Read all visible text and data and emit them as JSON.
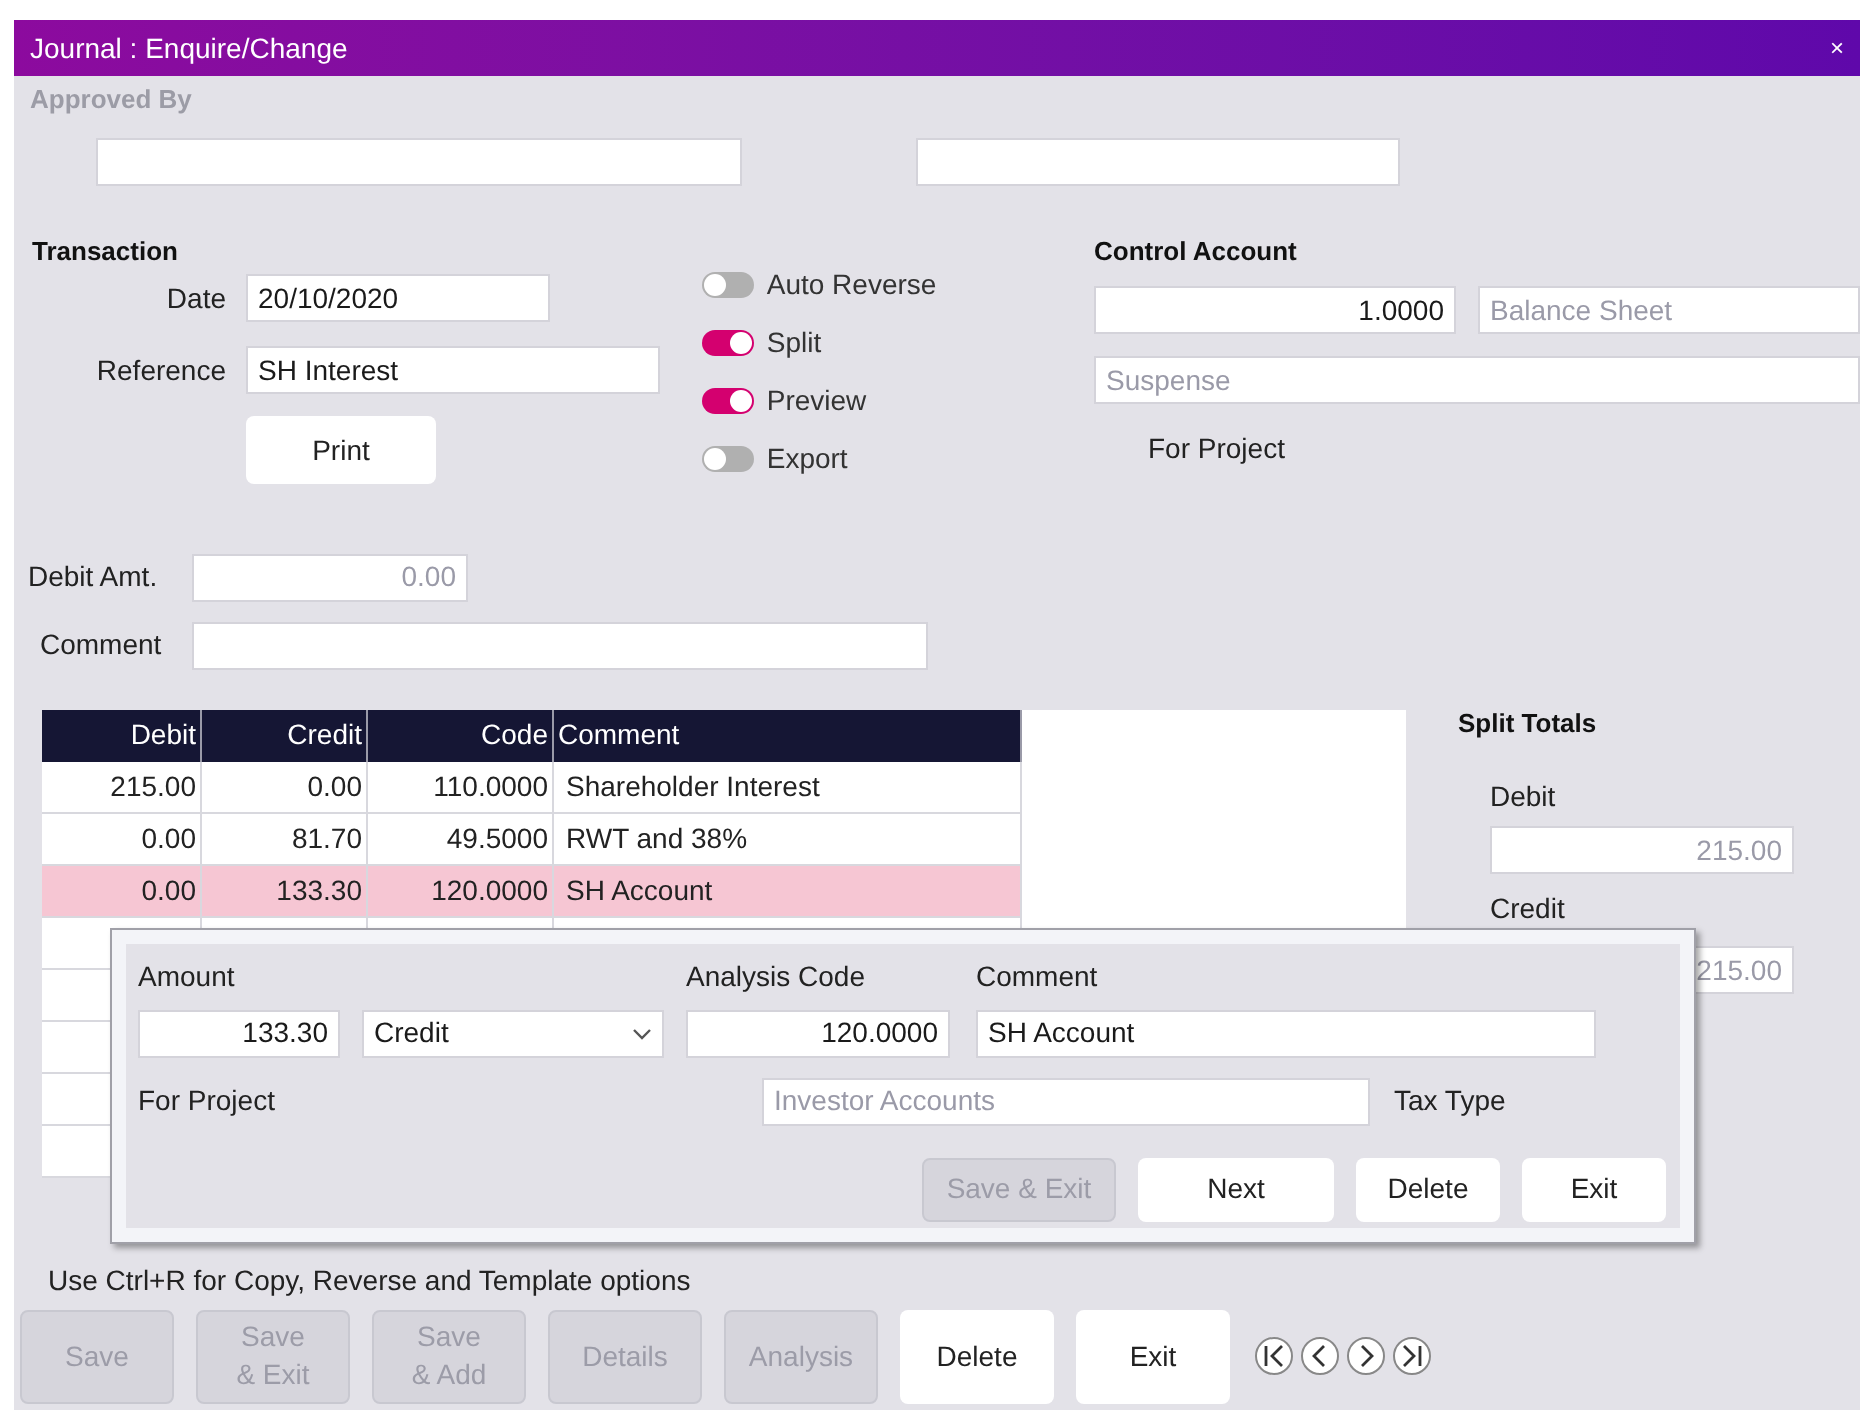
{
  "window": {
    "title": "Journal : Enquire/Change",
    "close": "×"
  },
  "approved_by": {
    "label": "Approved By"
  },
  "transaction": {
    "heading": "Transaction",
    "date": {
      "label": "Date",
      "value": "20/10/2020"
    },
    "reference": {
      "label": "Reference",
      "value": "SH Interest"
    },
    "print_button": "Print"
  },
  "toggles": [
    {
      "label": "Auto Reverse",
      "on": false
    },
    {
      "label": "Split",
      "on": true
    },
    {
      "label": "Preview",
      "on": true
    },
    {
      "label": "Export",
      "on": false
    }
  ],
  "control_account": {
    "heading": "Control Account",
    "rate": "1.0000",
    "type": "Balance Sheet",
    "account": "Suspense",
    "for_project": "For Project"
  },
  "debit_amount": {
    "label": "Debit Amt.",
    "value": "0.00"
  },
  "comment": {
    "label": "Comment"
  },
  "table": {
    "columns": [
      "Debit",
      "Credit",
      "Code",
      "Comment"
    ],
    "rows": [
      {
        "cells": [
          "215.00",
          "0.00",
          "110.0000",
          "Shareholder Interest"
        ],
        "selected": false
      },
      {
        "cells": [
          "0.00",
          "81.70",
          "49.5000",
          "RWT and 38%"
        ],
        "selected": false
      },
      {
        "cells": [
          "0.00",
          "133.30",
          "120.0000",
          "SH Account"
        ],
        "selected": true
      }
    ]
  },
  "split_totals": {
    "heading": "Split Totals",
    "debit": {
      "label": "Debit",
      "value": "215.00"
    },
    "credit": {
      "label": "Credit",
      "value": "215.00"
    }
  },
  "dialog": {
    "amount": {
      "label": "Amount",
      "value": "133.30"
    },
    "side": "Credit",
    "analysis_code": {
      "label": "Analysis Code",
      "value": "120.0000"
    },
    "comment": {
      "label": "Comment",
      "value": "SH Account"
    },
    "for_project": {
      "label": "For Project",
      "value": "Investor Accounts"
    },
    "tax_type": {
      "label": "Tax Type"
    },
    "buttons": [
      {
        "label": "Save & Exit",
        "disabled": true
      },
      {
        "label": "Next",
        "disabled": false
      },
      {
        "label": "Delete",
        "disabled": false
      },
      {
        "label": "Exit",
        "disabled": false
      }
    ]
  },
  "hint": "Use Ctrl+R for Copy, Reverse and Template options",
  "buttons": [
    {
      "lines": [
        "Save"
      ],
      "disabled": true
    },
    {
      "lines": [
        "Save",
        "& Exit"
      ],
      "disabled": true
    },
    {
      "lines": [
        "Save",
        "& Add"
      ],
      "disabled": true
    },
    {
      "lines": [
        "Details"
      ],
      "disabled": true
    },
    {
      "lines": [
        "Analysis"
      ],
      "disabled": true
    },
    {
      "lines": [
        "Delete"
      ],
      "disabled": false
    },
    {
      "lines": [
        "Exit"
      ],
      "disabled": false
    }
  ]
}
